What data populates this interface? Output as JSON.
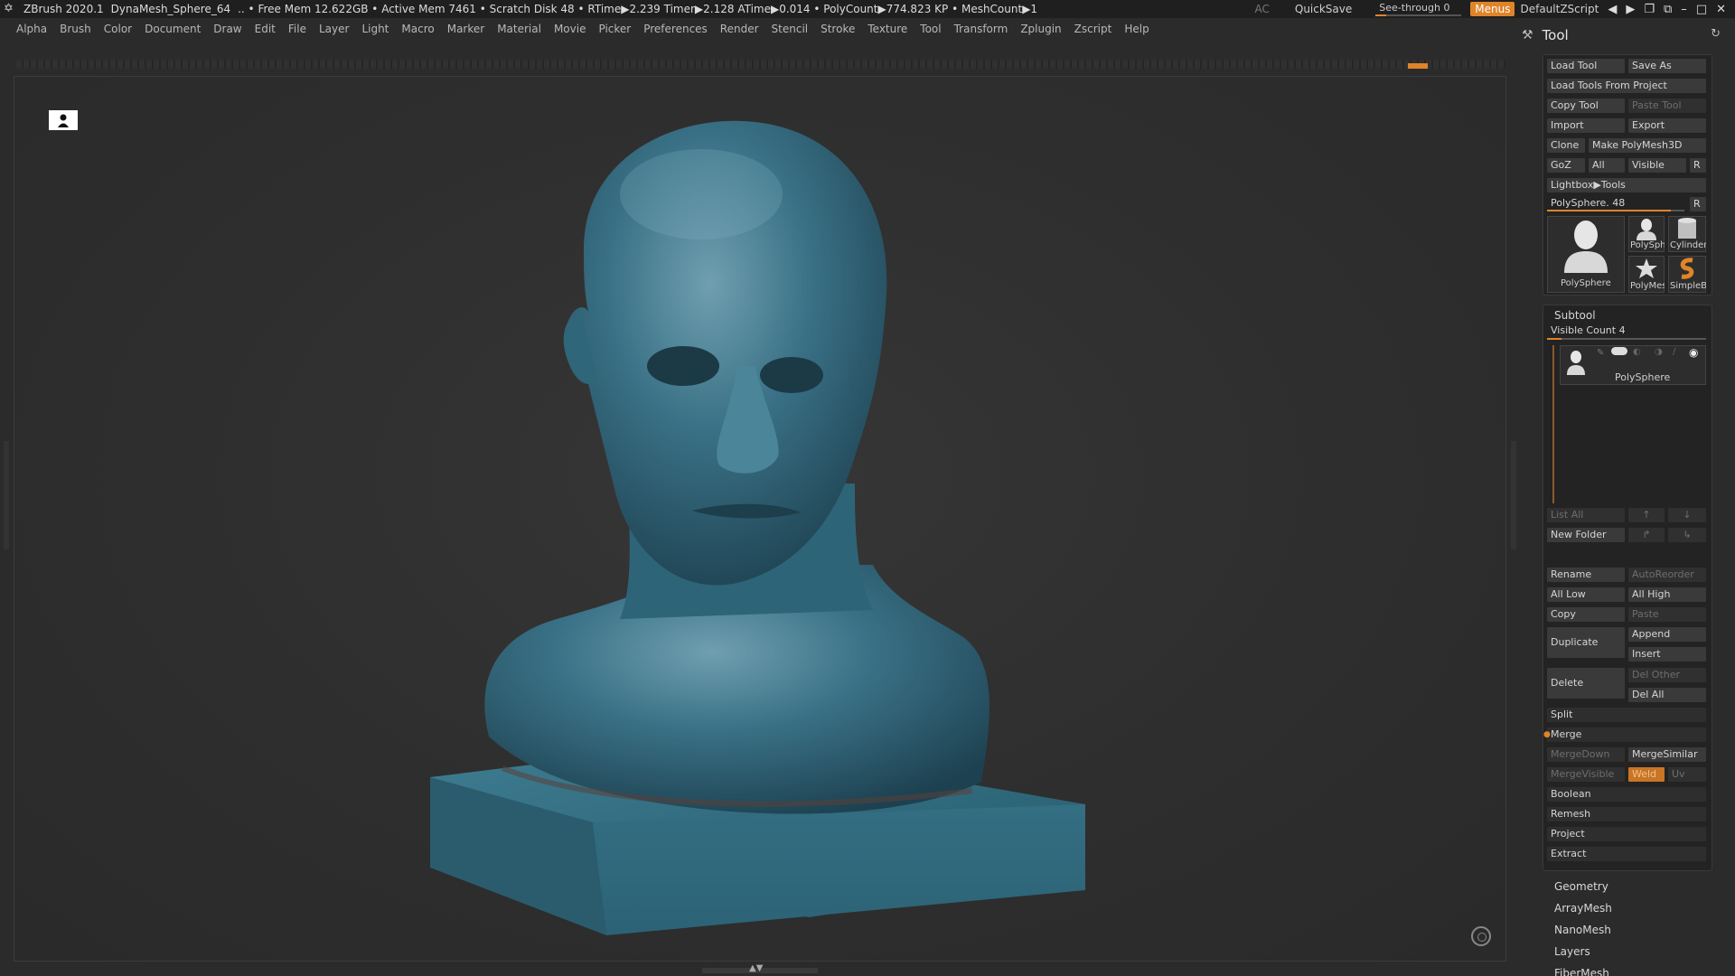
{
  "titlebar": {
    "app": "ZBrush 2020.1",
    "document": "DynaMesh_Sphere_64",
    "stats": ".. • Free Mem 12.622GB • Active Mem 7461 • Scratch Disk 48 •  RTime▶2.239 Timer▶2.128 ATime▶0.014 • PolyCount▶774.823 KP  • MeshCount▶1",
    "ac": "AC",
    "quicksave": "QuickSave",
    "see_through": "See-through  0",
    "menus": "Menus",
    "script": "DefaultZScript"
  },
  "menubar": [
    "Alpha",
    "Brush",
    "Color",
    "Document",
    "Draw",
    "Edit",
    "File",
    "Layer",
    "Light",
    "Macro",
    "Marker",
    "Material",
    "Movie",
    "Picker",
    "Preferences",
    "Render",
    "Stencil",
    "Stroke",
    "Texture",
    "Tool",
    "Transform",
    "Zplugin",
    "Zscript",
    "Help"
  ],
  "tool": {
    "title": "Tool",
    "load_tool": "Load Tool",
    "save_as": "Save As",
    "load_from_project": "Load Tools From Project",
    "copy_tool": "Copy Tool",
    "paste_tool": "Paste Tool",
    "import": "Import",
    "export": "Export",
    "clone": "Clone",
    "make_polymesh": "Make PolyMesh3D",
    "goz": "GoZ",
    "all": "All",
    "visible": "Visible",
    "r": "R",
    "lightbox_tools": "Lightbox▶Tools",
    "current_tool": "PolySphere. 48",
    "current_tool_value": 0.9,
    "thumbnails": [
      "PolySphere",
      "PolySphe",
      "Cylinder",
      "PolyMes",
      "SimpleB"
    ]
  },
  "subtool": {
    "title": "Subtool",
    "visible_count": "Visible Count 4",
    "item_name": "PolySphere",
    "list_all": "List All",
    "new_folder": "New Folder",
    "rename": "Rename",
    "autoreorder": "AutoReorder",
    "all_low": "All Low",
    "all_high": "All High",
    "copy": "Copy",
    "paste": "Paste",
    "duplicate": "Duplicate",
    "append": "Append",
    "insert": "Insert",
    "delete": "Delete",
    "del_other": "Del Other",
    "del_all": "Del All",
    "split": "Split",
    "merge": "Merge",
    "mergedown": "MergeDown",
    "mergesimilar": "MergeSimilar",
    "mergevisible": "MergeVisible",
    "weld": "Weld",
    "uv": "Uv",
    "boolean": "Boolean",
    "remesh": "Remesh",
    "project": "Project",
    "extract": "Extract"
  },
  "sections": [
    "Geometry",
    "ArrayMesh",
    "NanoMesh",
    "Layers",
    "FiberMesh"
  ],
  "colors": {
    "accent": "#e0842a",
    "model": "#3a7186",
    "background": "#2b2b2b"
  }
}
